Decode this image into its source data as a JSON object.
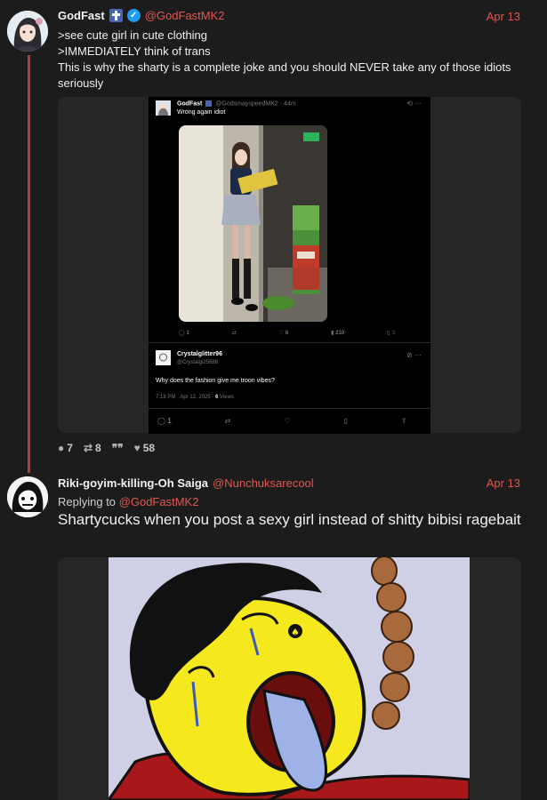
{
  "post1": {
    "name": "GodFast",
    "handle": "@GodFastMK2",
    "date": "Apr 13",
    "lines": [
      ">see cute girl in cute clothing",
      ">IMMEDIATELY think of trans",
      "This is why the sharty is a complete joke and you should NEVER take any of those idiots seriously"
    ],
    "badge_icon": "cross-icon",
    "verified_icon": "verified-icon",
    "embed": {
      "tweet": {
        "name": "GodFast",
        "handle": "@GodsmayspeedMK2 · 44m",
        "text": "Wrong again idiot",
        "actions": {
          "replies": "1",
          "reposts": "",
          "likes": "6",
          "views": "210"
        }
      },
      "reply": {
        "name": "Crystalglitter96",
        "handle": "@Crystalgl25688",
        "text": "Why does the fashion give me troon vibes?",
        "meta_time": "7:18 PM · Apr 12, 2025 · ",
        "meta_views_count": "6",
        "meta_views_label": " Views",
        "actions": {
          "replies": "1"
        }
      }
    },
    "stats": {
      "replies": "7",
      "reposts": "8",
      "quotes": "",
      "likes": "58"
    }
  },
  "post2": {
    "name": "Riki-goyim-killing-Oh Saiga",
    "handle": "@Nunchuksarecool",
    "date": "Apr 13",
    "replying_prefix": "Replying to ",
    "replying_handle": "@GodFastMK2",
    "text": "Shartycucks when you post a sexy girl instead of shitty bibisi ragebait"
  },
  "colors": {
    "accent": "#e0574f",
    "thread_line": "#b03a3a",
    "background": "#1c1c1c"
  }
}
